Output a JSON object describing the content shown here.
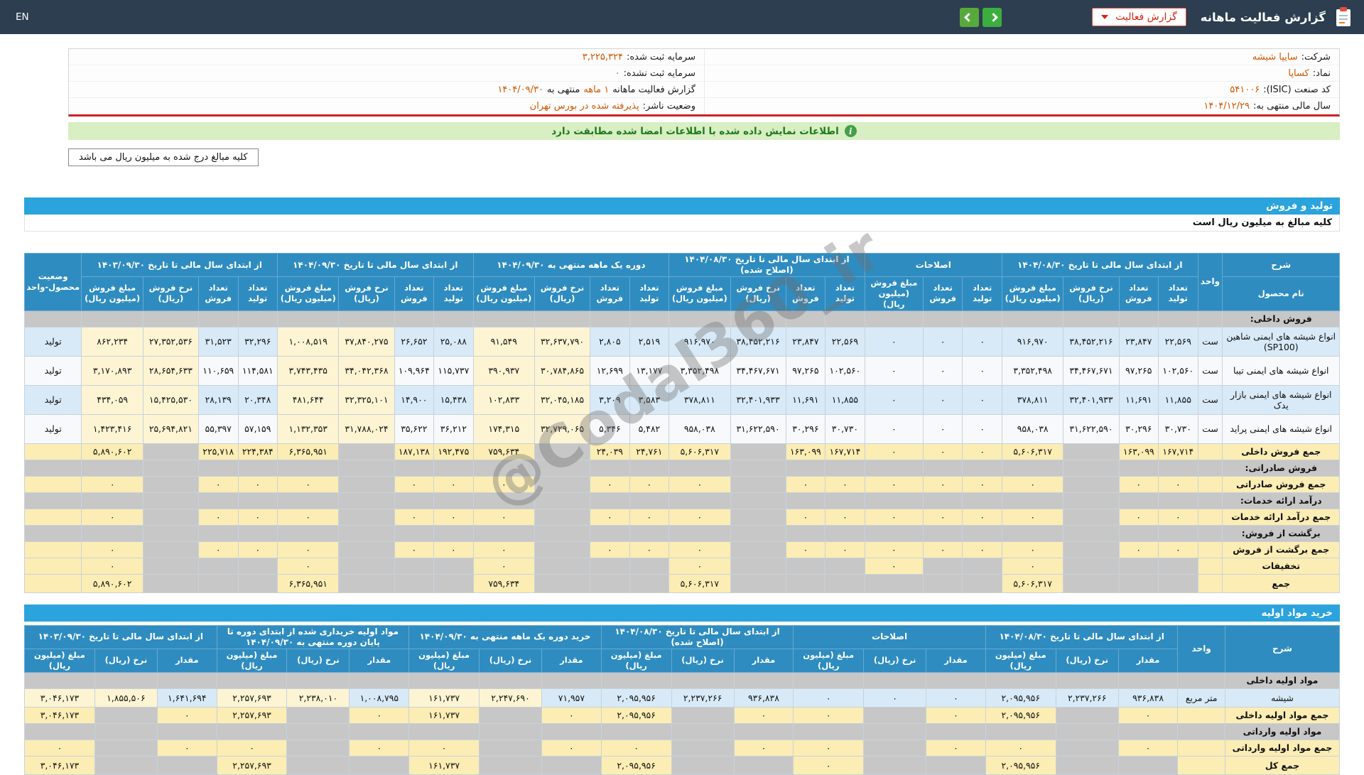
{
  "topbar": {
    "title": "گزارش فعالیت ماهانه",
    "dropdown_label": "گزارش فعالیت",
    "lang": "EN"
  },
  "company": {
    "right": [
      {
        "label": "شرکت:",
        "value": "سایپا شیشه"
      },
      {
        "label": "نماد:",
        "value": "کساپا"
      },
      {
        "label": "کد صنعت (ISIC):",
        "value": "۵۴۱۰۰۶"
      },
      {
        "label": "سال مالی منتهی به:",
        "value": "۱۴۰۴/۱۲/۲۹"
      }
    ],
    "left": [
      {
        "label": "سرمایه ثبت شده:",
        "value": "۳,۲۲۵,۳۲۴"
      },
      {
        "label": "سرمایه ثبت نشده:",
        "value": "۰"
      }
    ],
    "period": {
      "p1": "گزارش فعالیت ماهانه",
      "v1": "۱ ماهه",
      "p2": "منتهی به",
      "v2": "۱۴۰۴/۰۹/۳۰"
    },
    "publisher": {
      "label": "وضعیت ناشر:",
      "value": "پذیرفته شده در بورس تهران"
    }
  },
  "notices": {
    "signed_match": "اطلاعات نمایش داده شده با اطلاعات امضا شده مطابقت دارد",
    "amounts_box": "کلیه مبالغ درج شده به میلیون ریال می باشد"
  },
  "sections": {
    "production_title": "تولید و فروش",
    "production_note": "کلیه مبالغ به میلیون ریال است",
    "materials_title": "خرید مواد اولیه"
  },
  "watermark": "@Codal360_ir",
  "colors": {
    "topbar_navy": "#2c3e50",
    "accent_blue": "#2ba3dc",
    "header_blue": "#2f8cc0",
    "highlight_cream": "#fdf4d3",
    "total_yellow": "#fbedb4",
    "notice_green": "#d8eec3",
    "value_orange": "#d35400",
    "nav_green": "#3cae3f",
    "alert_red": "#cc2222"
  },
  "tables": {
    "production": {
      "name": "production-table",
      "cls": "production-table",
      "widths": {
        "label": 160,
        "unit": 34,
        "status": 78
      },
      "head": {
        "sharh": "شرح",
        "product": "نام محصول",
        "unit": "واحد",
        "status": "وضعیت محصول-واحد"
      },
      "groups": [
        {
          "label": "از ابتدای سال مالی تا تاریخ ۱۴۰۴/۰۸/۳۰",
          "cols": [
            "تعداد تولید",
            "تعداد فروش",
            "نرخ فروش (ریال)",
            "مبلغ فروش (میلیون ریال)"
          ],
          "widths": [
            54,
            54,
            76,
            84
          ],
          "hl": false
        },
        {
          "label": "اصلاحات",
          "cols": [
            "تعداد تولید",
            "تعداد فروش",
            "مبلغ فروش (میلیون ریال)"
          ],
          "widths": [
            54,
            54,
            80
          ],
          "hl": false
        },
        {
          "label": "از ابتدای سال مالی تا تاریخ ۱۴۰۴/۰۸/۳۰ (اصلاح شده)",
          "cols": [
            "تعداد تولید",
            "تعداد فروش",
            "نرخ فروش (ریال)",
            "مبلغ فروش (میلیون ریال)"
          ],
          "widths": [
            54,
            54,
            76,
            84
          ],
          "hl": false
        },
        {
          "label": "دوره یک ماهه منتهی به ۱۴۰۴/۰۹/۳۰",
          "cols": [
            "تعداد تولید",
            "تعداد فروش",
            "نرخ فروش (ریال)",
            "مبلغ فروش (میلیون ریال)"
          ],
          "widths": [
            54,
            54,
            76,
            84
          ],
          "hl": true
        },
        {
          "label": "از ابتدای سال مالی تا تاریخ ۱۴۰۴/۰۹/۳۰",
          "cols": [
            "تعداد تولید",
            "تعداد فروش",
            "نرخ فروش (ریال)",
            "مبلغ فروش (میلیون ریال)"
          ],
          "widths": [
            54,
            54,
            76,
            84
          ],
          "hl": true
        },
        {
          "label": "از ابتدای سال مالی تا تاریخ ۱۴۰۳/۰۹/۳۰",
          "cols": [
            "تعداد تولید",
            "تعداد فروش",
            "نرخ فروش (ریال)",
            "مبلغ فروش (میلیون ریال)"
          ],
          "widths": [
            54,
            54,
            76,
            84
          ],
          "hl": true
        }
      ],
      "rows": [
        {
          "type": "section",
          "label": "فروش داخلی:"
        },
        {
          "type": "data",
          "label": "انواع شیشه های ایمنی شاهین (SP100)",
          "unit": "ست",
          "status": "تولید",
          "cells": [
            [
              "۲۲,۵۶۹",
              "۲۳,۸۴۷",
              "۳۸,۴۵۲,۲۱۶",
              "۹۱۶,۹۷۰"
            ],
            [
              "۰",
              "۰",
              "۰"
            ],
            [
              "۲۲,۵۶۹",
              "۲۳,۸۴۷",
              "۳۸,۴۵۲,۲۱۶",
              "۹۱۶,۹۷۰"
            ],
            [
              "۲,۵۱۹",
              "۲,۸۰۵",
              "۳۲,۶۳۷,۷۹۰",
              "۹۱,۵۴۹"
            ],
            [
              "۲۵,۰۸۸",
              "۲۶,۶۵۲",
              "۳۷,۸۴۰,۲۷۵",
              "۱,۰۰۸,۵۱۹"
            ],
            [
              "۳۲,۲۹۶",
              "۳۱,۵۲۳",
              "۲۷,۳۵۲,۵۳۶",
              "۸۶۲,۲۳۴"
            ]
          ]
        },
        {
          "type": "data",
          "label": "انواع شیشه های ایمنی تیبا",
          "unit": "ست",
          "status": "تولید",
          "cells": [
            [
              "۱۰۲,۵۶۰",
              "۹۷,۲۶۵",
              "۳۴,۴۶۷,۶۷۱",
              "۳,۳۵۲,۴۹۸"
            ],
            [
              "۰",
              "۰",
              "۰"
            ],
            [
              "۱۰۲,۵۶۰",
              "۹۷,۲۶۵",
              "۳۴,۴۶۷,۶۷۱",
              "۳,۳۵۲,۴۹۸"
            ],
            [
              "۱۳,۱۷۷",
              "۱۲,۶۹۹",
              "۳۰,۷۸۴,۸۶۵",
              "۳۹۰,۹۳۷"
            ],
            [
              "۱۱۵,۷۳۷",
              "۱۰۹,۹۶۴",
              "۳۴,۰۴۲,۳۶۸",
              "۳,۷۴۳,۴۳۵"
            ],
            [
              "۱۱۴,۵۸۱",
              "۱۱۰,۶۵۹",
              "۲۸,۶۵۴,۶۳۳",
              "۳,۱۷۰,۸۹۳"
            ]
          ]
        },
        {
          "type": "data",
          "label": "انواع شیشه های ایمنی بازار یدک",
          "unit": "ست",
          "status": "تولید",
          "cells": [
            [
              "۱۱,۸۵۵",
              "۱۱,۶۹۱",
              "۳۲,۴۰۱,۹۳۳",
              "۳۷۸,۸۱۱"
            ],
            [
              "۰",
              "۰",
              "۰"
            ],
            [
              "۱۱,۸۵۵",
              "۱۱,۶۹۱",
              "۳۲,۴۰۱,۹۳۳",
              "۳۷۸,۸۱۱"
            ],
            [
              "۳,۵۸۳",
              "۳,۲۰۹",
              "۳۲,۰۴۵,۱۸۵",
              "۱۰۲,۸۳۳"
            ],
            [
              "۱۵,۴۳۸",
              "۱۴,۹۰۰",
              "۳۲,۳۲۵,۱۰۱",
              "۴۸۱,۶۴۴"
            ],
            [
              "۲۰,۳۴۸",
              "۲۸,۱۳۹",
              "۱۵,۴۲۵,۵۳۰",
              "۴۳۴,۰۵۹"
            ]
          ]
        },
        {
          "type": "data",
          "label": "انواع شیشه های ایمنی پراید",
          "unit": "ست",
          "status": "تولید",
          "cells": [
            [
              "۳۰,۷۳۰",
              "۳۰,۲۹۶",
              "۳۱,۶۲۲,۵۹۰",
              "۹۵۸,۰۳۸"
            ],
            [
              "۰",
              "۰",
              "۰"
            ],
            [
              "۳۰,۷۳۰",
              "۳۰,۲۹۶",
              "۳۱,۶۲۲,۵۹۰",
              "۹۵۸,۰۳۸"
            ],
            [
              "۵,۴۸۲",
              "۵,۳۴۶",
              "۳۲,۷۲۹,۰۶۵",
              "۱۷۴,۳۱۵"
            ],
            [
              "۳۶,۲۱۲",
              "۳۵,۶۲۲",
              "۳۱,۷۸۸,۰۲۴",
              "۱,۱۳۲,۳۵۳"
            ],
            [
              "۵۷,۱۵۹",
              "۵۵,۳۹۷",
              "۲۵,۶۹۴,۸۲۱",
              "۱,۴۲۳,۴۱۶"
            ]
          ]
        },
        {
          "type": "total",
          "label": "جمع فروش داخلی",
          "cells": [
            [
              "۱۶۷,۷۱۴",
              "۱۶۳,۰۹۹",
              null,
              "۵,۶۰۶,۳۱۷"
            ],
            [
              "۰",
              "۰",
              "۰"
            ],
            [
              "۱۶۷,۷۱۴",
              "۱۶۳,۰۹۹",
              null,
              "۵,۶۰۶,۳۱۷"
            ],
            [
              "۲۴,۷۶۱",
              "۲۴,۰۳۹",
              null,
              "۷۵۹,۶۳۴"
            ],
            [
              "۱۹۲,۴۷۵",
              "۱۸۷,۱۳۸",
              null,
              "۶,۳۶۵,۹۵۱"
            ],
            [
              "۲۲۴,۳۸۴",
              "۲۲۵,۷۱۸",
              null,
              "۵,۸۹۰,۶۰۲"
            ]
          ]
        },
        {
          "type": "section",
          "label": "فروش صادراتی:"
        },
        {
          "type": "total",
          "label": "جمع فروش صادراتی",
          "cells": [
            [
              "۰",
              "۰",
              null,
              "۰"
            ],
            [
              "۰",
              "۰",
              "۰"
            ],
            [
              "۰",
              "۰",
              null,
              "۰"
            ],
            [
              "۰",
              "۰",
              null,
              "۰"
            ],
            [
              "۰",
              "۰",
              null,
              "۰"
            ],
            [
              "۰",
              "۰",
              null,
              "۰"
            ]
          ]
        },
        {
          "type": "section",
          "label": "درآمد ارائه خدمات:"
        },
        {
          "type": "total",
          "label": "جمع درآمد ارائه خدمات",
          "cells": [
            [
              "۰",
              "۰",
              null,
              "۰"
            ],
            [
              "۰",
              "۰",
              "۰"
            ],
            [
              "۰",
              "۰",
              null,
              "۰"
            ],
            [
              "۰",
              "۰",
              null,
              "۰"
            ],
            [
              "۰",
              "۰",
              null,
              "۰"
            ],
            [
              "۰",
              "۰",
              null,
              "۰"
            ]
          ]
        },
        {
          "type": "section",
          "label": "برگشت از فروش:"
        },
        {
          "type": "total",
          "label": "جمع برگشت از فروش",
          "cells": [
            [
              "۰",
              "۰",
              null,
              "۰"
            ],
            [
              "۰",
              "۰",
              "۰"
            ],
            [
              "۰",
              "۰",
              null,
              "۰"
            ],
            [
              "۰",
              "۰",
              null,
              "۰"
            ],
            [
              "۰",
              "۰",
              null,
              "۰"
            ],
            [
              "۰",
              "۰",
              null,
              "۰"
            ]
          ]
        },
        {
          "type": "total",
          "label": "تخفیفات",
          "cells": [
            [
              null,
              null,
              null,
              "۰"
            ],
            [
              null,
              null,
              "۰"
            ],
            [
              null,
              null,
              null,
              "۰"
            ],
            [
              null,
              null,
              null,
              "۰"
            ],
            [
              null,
              null,
              null,
              "۰"
            ],
            [
              null,
              null,
              null,
              "۰"
            ]
          ]
        },
        {
          "type": "grand",
          "label": "جمع",
          "cells": [
            [
              null,
              null,
              null,
              "۵,۶۰۶,۳۱۷"
            ],
            [
              null,
              null,
              null
            ],
            [
              null,
              null,
              null,
              "۵,۶۰۶,۳۱۷"
            ],
            [
              null,
              null,
              null,
              "۷۵۹,۶۳۴"
            ],
            [
              null,
              null,
              null,
              "۶,۳۶۵,۹۵۱"
            ],
            [
              null,
              null,
              null,
              "۵,۸۹۰,۶۰۲"
            ]
          ]
        }
      ]
    },
    "materials": {
      "name": "materials-table",
      "cls": "materials-table",
      "widths": {
        "label": 150,
        "unit": 62
      },
      "head": {
        "sharh": "شرح",
        "unit": "واحد"
      },
      "groups": [
        {
          "label": "از ابتدای سال مالی تا تاریخ ۱۴۰۴/۰۸/۳۰",
          "cols": [
            "مقدار",
            "نرخ (ریال)",
            "مبلغ (میلیون ریال)"
          ],
          "widths": [
            78,
            82,
            92
          ],
          "hl": false
        },
        {
          "label": "اصلاحات",
          "cols": [
            "مقدار",
            "نرخ (ریال)",
            "مبلغ (میلیون ریال)"
          ],
          "widths": [
            78,
            82,
            92
          ],
          "hl": false
        },
        {
          "label": "از ابتدای سال مالی تا تاریخ ۱۴۰۴/۰۸/۳۰ (اصلاح شده)",
          "cols": [
            "مقدار",
            "نرخ (ریال)",
            "مبلغ (میلیون ریال)"
          ],
          "widths": [
            78,
            82,
            92
          ],
          "hl": false
        },
        {
          "label": "خرید دوره یک ماهه منتهی به ۱۴۰۴/۰۹/۳۰",
          "cols": [
            "مقدار",
            "نرخ (ریال)",
            "مبلغ (میلیون ریال)"
          ],
          "widths": [
            78,
            82,
            92
          ],
          "hl": true
        },
        {
          "label": "مواد اولیه خریداری شده از ابتدای دوره تا پایان دوره منتهی به ۱۴۰۴/۰۹/۳۰",
          "cols": [
            "مقدار",
            "نرخ (ریال)",
            "مبلغ (میلیون ریال)"
          ],
          "widths": [
            78,
            82,
            92
          ],
          "hl": true
        },
        {
          "label": "از ابتدای سال مالی تا تاریخ ۱۴۰۳/۰۹/۳۰",
          "cols": [
            "مقدار",
            "نرخ (ریال)",
            "مبلغ (میلیون ریال)"
          ],
          "widths": [
            78,
            82,
            92
          ],
          "hl": true
        }
      ],
      "rows": [
        {
          "type": "section",
          "label": "مواد اولیه داخلی"
        },
        {
          "type": "data",
          "label": "شیشه",
          "unit": "متر مربع",
          "cells": [
            [
              "۹۳۶,۸۳۸",
              "۲,۲۳۷,۲۶۶",
              "۲,۰۹۵,۹۵۶"
            ],
            [
              "۰",
              "۰",
              "۰"
            ],
            [
              "۹۳۶,۸۳۸",
              "۲,۲۳۷,۲۶۶",
              "۲,۰۹۵,۹۵۶"
            ],
            [
              "۷۱,۹۵۷",
              "۲,۲۴۷,۶۹۰",
              "۱۶۱,۷۳۷"
            ],
            [
              "۱,۰۰۸,۷۹۵",
              "۲,۲۳۸,۰۱۰",
              "۲,۲۵۷,۶۹۳"
            ],
            [
              "۱,۶۴۱,۶۹۴",
              "۱,۸۵۵,۵۰۶",
              "۳,۰۴۶,۱۷۳"
            ]
          ]
        },
        {
          "type": "total",
          "label": "جمع مواد اولیه داخلی",
          "cells": [
            [
              "۰",
              null,
              "۲,۰۹۵,۹۵۶"
            ],
            [
              "۰",
              null,
              "۰"
            ],
            [
              "۰",
              null,
              "۲,۰۹۵,۹۵۶"
            ],
            [
              "۰",
              null,
              "۱۶۱,۷۳۷"
            ],
            [
              "۰",
              null,
              "۲,۲۵۷,۶۹۳"
            ],
            [
              "۰",
              null,
              "۳,۰۴۶,۱۷۳"
            ]
          ]
        },
        {
          "type": "section",
          "label": "مواد اولیه وارداتی"
        },
        {
          "type": "total",
          "label": "جمع مواد اولیه وارداتی",
          "cells": [
            [
              "۰",
              null,
              "۰"
            ],
            [
              "۰",
              null,
              "۰"
            ],
            [
              "۰",
              null,
              "۰"
            ],
            [
              "۰",
              null,
              "۰"
            ],
            [
              "۰",
              null,
              "۰"
            ],
            [
              "۰",
              null,
              "۰"
            ]
          ]
        },
        {
          "type": "grand",
          "label": "جمع کل",
          "cells": [
            [
              null,
              null,
              "۲,۰۹۵,۹۵۶"
            ],
            [
              null,
              null,
              "۰"
            ],
            [
              null,
              null,
              "۲,۰۹۵,۹۵۶"
            ],
            [
              null,
              null,
              "۱۶۱,۷۳۷"
            ],
            [
              null,
              null,
              "۲,۲۵۷,۶۹۳"
            ],
            [
              null,
              null,
              "۳,۰۴۶,۱۷۳"
            ]
          ]
        }
      ]
    }
  }
}
